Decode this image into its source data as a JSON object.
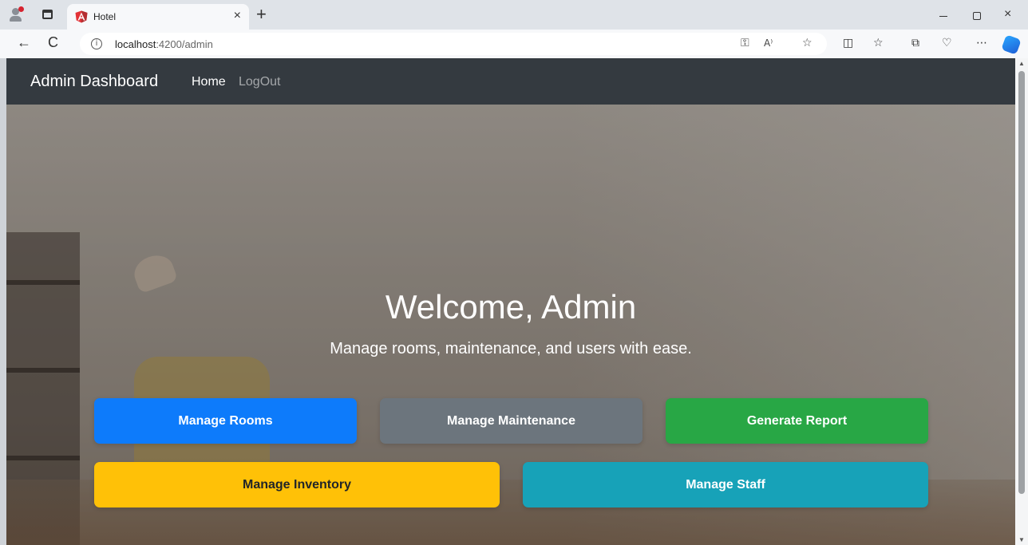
{
  "browser": {
    "tab": {
      "title": "Hotel",
      "close_glyph": "×"
    },
    "new_tab_glyph": "+",
    "address": {
      "host": "localhost",
      "path": ":4200/admin"
    },
    "nav": {
      "back_glyph": "←",
      "reload_glyph": "C"
    },
    "window": {
      "minimize": "",
      "close": "×"
    },
    "icons": [
      "profile-icon",
      "workspaces-icon",
      "angular-favicon",
      "info-icon",
      "key-icon",
      "read-aloud-icon",
      "favorite-star-icon",
      "split-screen-icon",
      "favorites-icon",
      "collections-icon",
      "browser-essentials-icon",
      "more-icon",
      "copilot-icon"
    ]
  },
  "navbar": {
    "brand": "Admin Dashboard",
    "links": {
      "home": "Home",
      "logout": "LogOut"
    }
  },
  "hero": {
    "title": "Welcome, Admin",
    "subtitle": "Manage rooms, maintenance, and users with ease."
  },
  "actions": {
    "rooms": "Manage Rooms",
    "maintenance": "Manage Maintenance",
    "report": "Generate Report",
    "inventory": "Manage Inventory",
    "staff": "Manage Staff"
  },
  "colors": {
    "primary": "#0d7bfb",
    "secondary": "#6c757d",
    "success": "#28a745",
    "warning": "#ffc107",
    "info": "#17a2b8",
    "navbar": "#343a40"
  }
}
